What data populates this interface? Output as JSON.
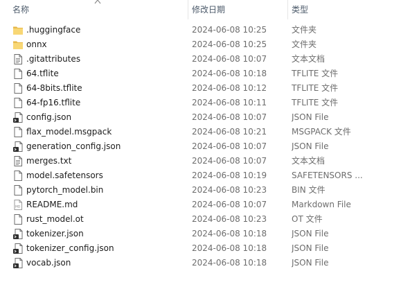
{
  "columns": {
    "name": "名称",
    "date": "修改日期",
    "type": "类型"
  },
  "files": [
    {
      "name": ".huggingface",
      "date": "2024-06-08 10:25",
      "type": "文件夹",
      "icon": "folder-icon"
    },
    {
      "name": "onnx",
      "date": "2024-06-08 10:25",
      "type": "文件夹",
      "icon": "folder-icon"
    },
    {
      "name": ".gitattributes",
      "date": "2024-06-08 10:07",
      "type": "文本文档",
      "icon": "text-file-icon"
    },
    {
      "name": "64.tflite",
      "date": "2024-06-08 10:18",
      "type": "TFLITE 文件",
      "icon": "file-icon"
    },
    {
      "name": "64-8bits.tflite",
      "date": "2024-06-08 10:12",
      "type": "TFLITE 文件",
      "icon": "file-icon"
    },
    {
      "name": "64-fp16.tflite",
      "date": "2024-06-08 10:11",
      "type": "TFLITE 文件",
      "icon": "file-icon"
    },
    {
      "name": "config.json",
      "date": "2024-06-08 10:07",
      "type": "JSON File",
      "icon": "json-file-icon"
    },
    {
      "name": "flax_model.msgpack",
      "date": "2024-06-08 10:21",
      "type": "MSGPACK 文件",
      "icon": "file-icon"
    },
    {
      "name": "generation_config.json",
      "date": "2024-06-08 10:07",
      "type": "JSON File",
      "icon": "json-file-icon"
    },
    {
      "name": "merges.txt",
      "date": "2024-06-08 10:07",
      "type": "文本文档",
      "icon": "text-file-icon"
    },
    {
      "name": "model.safetensors",
      "date": "2024-06-08 10:19",
      "type": "SAFETENSORS ...",
      "icon": "file-icon"
    },
    {
      "name": "pytorch_model.bin",
      "date": "2024-06-08 10:23",
      "type": "BIN 文件",
      "icon": "file-icon"
    },
    {
      "name": "README.md",
      "date": "2024-06-08 10:07",
      "type": "Markdown File",
      "icon": "markdown-file-icon"
    },
    {
      "name": "rust_model.ot",
      "date": "2024-06-08 10:23",
      "type": "OT 文件",
      "icon": "file-icon"
    },
    {
      "name": "tokenizer.json",
      "date": "2024-06-08 10:18",
      "type": "JSON File",
      "icon": "json-file-icon"
    },
    {
      "name": "tokenizer_config.json",
      "date": "2024-06-08 10:18",
      "type": "JSON File",
      "icon": "json-file-icon"
    },
    {
      "name": "vocab.json",
      "date": "2024-06-08 10:18",
      "type": "JSON File",
      "icon": "json-file-icon"
    }
  ],
  "colors": {
    "folder": "#f8d775",
    "header_text": "#4c5a6a",
    "secondary_text": "#6d6d6d"
  }
}
